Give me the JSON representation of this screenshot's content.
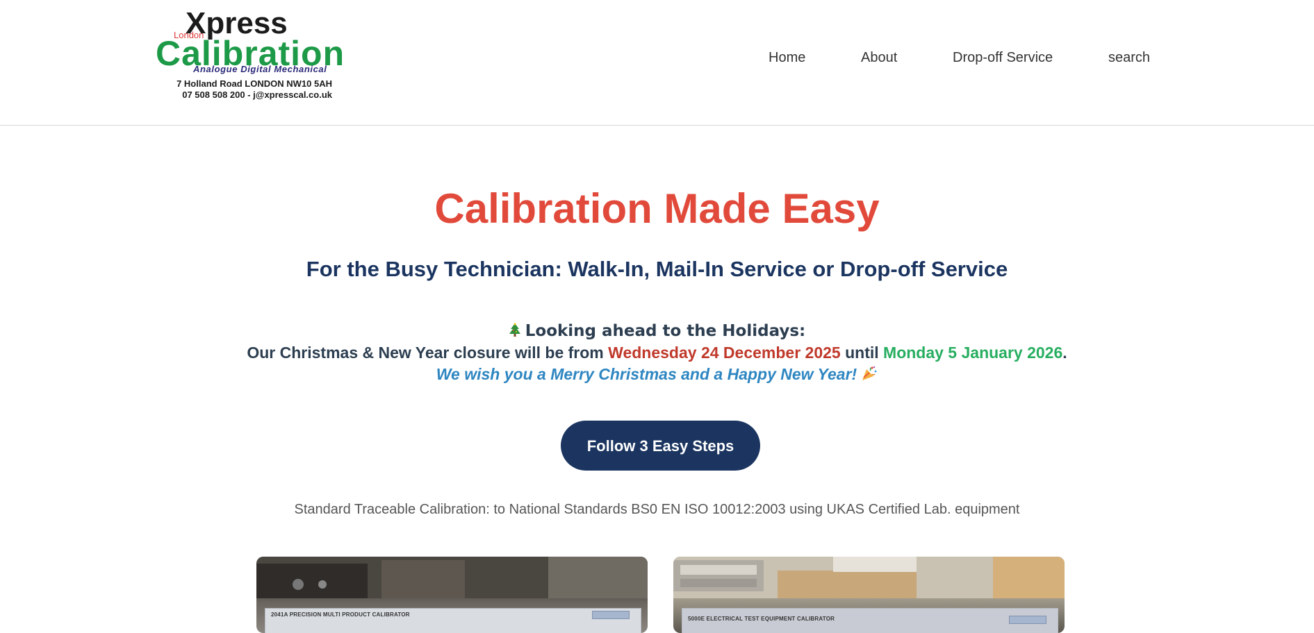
{
  "logo": {
    "xpress": "Xpress",
    "london": "London",
    "calibration": "Calibration",
    "tagline": "Analogue  Digital  Mechanical",
    "address": "7 Holland Road  LONDON  NW10 5AH",
    "contact": "07 508 508 200  -  j@xpresscal.co.uk",
    "colors": {
      "xpress": "#1b1b1b",
      "london": "#e03a3a",
      "calibration": "#1d9a47",
      "tagline": "#2c2a7a"
    }
  },
  "nav": {
    "items": [
      {
        "label": "Home"
      },
      {
        "label": "About"
      },
      {
        "label": "Drop-off Service"
      },
      {
        "label": "search"
      }
    ]
  },
  "hero": {
    "title": "Calibration Made Easy",
    "subtitle": "For the Busy Technician: Walk-In, Mail-In Service or Drop-off Service",
    "colors": {
      "title": "#e14a3b",
      "subtitle": "#1b3560"
    }
  },
  "holiday": {
    "heading": "Looking ahead to the Holidays:",
    "closure_prefix": "Our Christmas & New Year closure will be from ",
    "closure_start": "Wednesday 24 December 2025",
    "closure_mid": " until ",
    "closure_end": "Monday 5 January 2026",
    "closure_suffix": ".",
    "wish": "We wish you a Merry Christmas and a Happy New Year!",
    "icons": [
      "christmas-tree-icon",
      "party-popper-icon"
    ],
    "colors": {
      "start": "#c0392b",
      "end": "#27ae60",
      "wish": "#2e86c1"
    }
  },
  "cta": {
    "label": "Follow 3 Easy Steps",
    "color": "#1b3560"
  },
  "standard_text": "Standard Traceable Calibration: to National Standards BS0 EN ISO 10012:2003 using UKAS Certified Lab. equipment",
  "photos": [
    {
      "panel_label": "2041A PRECISION MULTI PRODUCT CALIBRATOR"
    },
    {
      "panel_label": "5000E ELECTRICAL TEST EQUIPMENT CALIBRATOR"
    }
  ]
}
